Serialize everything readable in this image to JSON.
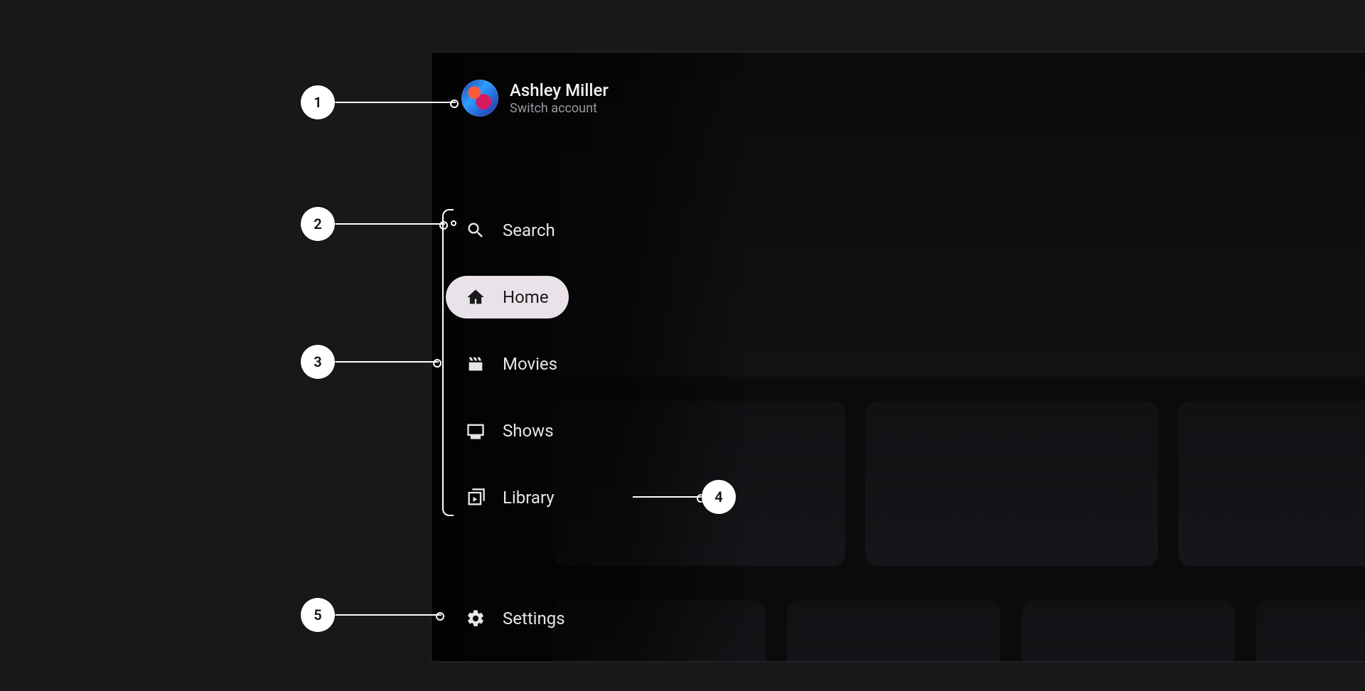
{
  "account": {
    "name": "Ashley Miller",
    "subtitle": "Switch account"
  },
  "nav": {
    "items": [
      {
        "label": "Search",
        "icon": "search-icon",
        "active": false
      },
      {
        "label": "Home",
        "icon": "home-icon",
        "active": true
      },
      {
        "label": "Movies",
        "icon": "clapper-icon",
        "active": false
      },
      {
        "label": "Shows",
        "icon": "tv-icon",
        "active": false
      },
      {
        "label": "Library",
        "icon": "library-icon",
        "active": false
      }
    ],
    "footer": {
      "label": "Settings",
      "icon": "gear-icon"
    }
  },
  "annotations": [
    {
      "id": "1"
    },
    {
      "id": "2"
    },
    {
      "id": "3"
    },
    {
      "id": "4"
    },
    {
      "id": "5"
    }
  ]
}
